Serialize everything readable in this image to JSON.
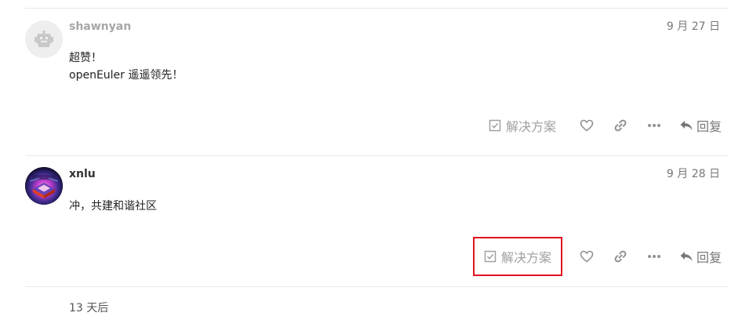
{
  "posts": [
    {
      "username": "shawnyan",
      "date": "9 月 27 日",
      "body_lines": [
        "超赞！",
        "openEuler 遥遥领先！"
      ],
      "solution_label": "解决方案",
      "reply_label": "回复"
    },
    {
      "username": "xnlu",
      "date": "9 月 28 日",
      "body_lines": [
        "冲，共建和谐社区"
      ],
      "solution_label": "解决方案",
      "reply_label": "回复"
    }
  ],
  "footer": {
    "time_gap": "13 天后"
  },
  "colors": {
    "highlight_border": "#e0141e",
    "muted_icon": "#929292",
    "divider": "#e9e9e9"
  }
}
